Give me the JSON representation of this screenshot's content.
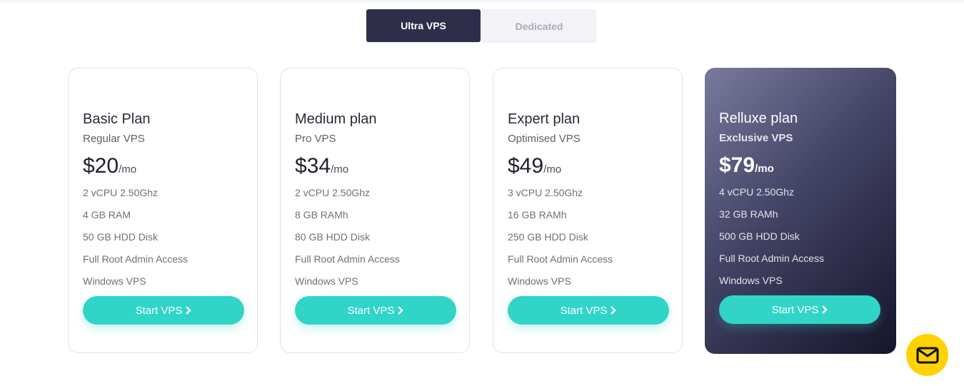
{
  "tabs": [
    {
      "label": "Ultra VPS",
      "active": true
    },
    {
      "label": "Dedicated",
      "active": false
    }
  ],
  "plans": [
    {
      "name": "Basic Plan",
      "subtitle": "Regular VPS",
      "price": "$20",
      "unit": "/mo",
      "features": [
        "2 vCPU 2.50Ghz",
        "4 GB RAM",
        "50 GB HDD Disk",
        "Full Root Admin Access",
        "Windows VPS"
      ],
      "button": "Start VPS"
    },
    {
      "name": "Medium plan",
      "subtitle": "Pro VPS",
      "price": "$34",
      "unit": "/mo",
      "features": [
        "2 vCPU 2.50Ghz",
        "8 GB RAMh",
        "80 GB HDD Disk",
        "Full Root Admin Access",
        "Windows VPS"
      ],
      "button": "Start VPS"
    },
    {
      "name": "Expert plan",
      "subtitle": "Optimised VPS",
      "price": "$49",
      "unit": "/mo",
      "features": [
        "3 vCPU 2.50Ghz",
        "16 GB RAMh",
        "250 GB HDD Disk",
        "Full Root Admin Access",
        "Windows VPS"
      ],
      "button": "Start VPS"
    },
    {
      "name": "Relluxe plan",
      "subtitle": "Exclusive VPS",
      "price": "$79",
      "unit": "/mo",
      "features": [
        "4 vCPU 2.50Ghz",
        "32 GB RAMh",
        "500 GB HDD Disk",
        "Full Root Admin Access",
        "Windows VPS"
      ],
      "button": "Start VPS"
    }
  ],
  "colors": {
    "accent": "#30d5c8",
    "tab_active": "#2e2e4b",
    "fab": "#ffd200"
  },
  "icons": {
    "button_icon": "chevron-right-icon",
    "fab_icon": "mail-icon"
  }
}
